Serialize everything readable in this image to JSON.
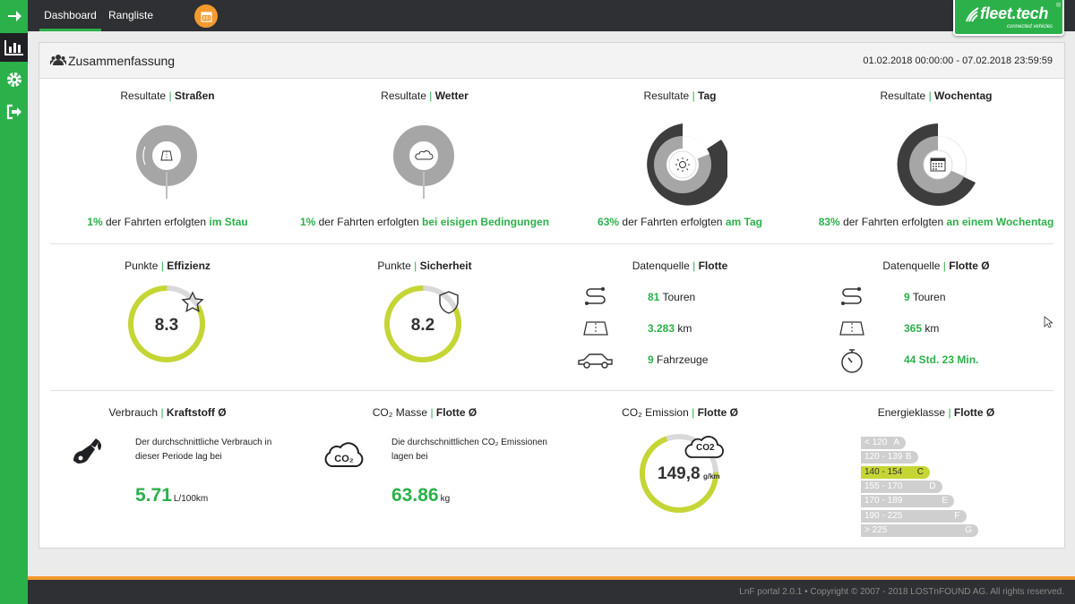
{
  "nav": {
    "tabs": [
      {
        "label": "Dashboard"
      },
      {
        "label": "Rangliste"
      }
    ],
    "logo": {
      "text": "fleet.tech",
      "tagline": "connected vehicles",
      "mark": "®"
    }
  },
  "sidebar": {
    "items": [
      {
        "icon": "arrow-right-icon"
      },
      {
        "icon": "bar-chart-icon",
        "active": true
      },
      {
        "icon": "gear-icon"
      },
      {
        "icon": "sign-out-icon"
      }
    ]
  },
  "summary": {
    "title": "Zusammenfassung",
    "date_range": "01.02.2018 00:00:00 - 07.02.2018 23:59:59"
  },
  "results": [
    {
      "label": "Resultate",
      "sep": "|",
      "name": "Straßen",
      "percent": "1%",
      "text": "der Fahrten erfolgten",
      "highlight": "im Stau",
      "share": 0.01
    },
    {
      "label": "Resultate",
      "sep": "|",
      "name": "Wetter",
      "percent": "1%",
      "text": "der Fahrten erfolgten",
      "highlight": "bei eisigen Bedingungen",
      "share": 0.01
    },
    {
      "label": "Resultate",
      "sep": "|",
      "name": "Tag",
      "percent": "63%",
      "text": "der Fahrten erfolgten",
      "highlight": "am Tag",
      "share": 0.63
    },
    {
      "label": "Resultate",
      "sep": "|",
      "name": "Wochentag",
      "percent": "83%",
      "text": "der Fahrten erfolgten",
      "highlight": "an einem Wochentag",
      "share": 0.83
    }
  ],
  "points": [
    {
      "label": "Punkte",
      "sep": "|",
      "name": "Effizienz",
      "value": "8.3",
      "score": 8.3
    },
    {
      "label": "Punkte",
      "sep": "|",
      "name": "Sicherheit",
      "value": "8.2",
      "score": 8.2
    }
  ],
  "source_fleet": {
    "label": "Datenquelle",
    "sep": "|",
    "name": "Flotte",
    "rows": [
      {
        "value": "81",
        "unit": "Touren"
      },
      {
        "value": "3.283",
        "unit": "km"
      },
      {
        "value": "9",
        "unit": "Fahrzeuge"
      }
    ]
  },
  "source_avg": {
    "label": "Datenquelle",
    "sep": "|",
    "name": "Flotte Ø",
    "rows": [
      {
        "value": "9",
        "unit": "Touren"
      },
      {
        "value": "365",
        "unit": "km"
      },
      {
        "value": "44 Std. 23 Min.",
        "unit": ""
      }
    ]
  },
  "consumption": {
    "label": "Verbrauch",
    "sep": "|",
    "name": "Kraftstoff Ø",
    "desc": "Der durchschnittliche Verbrauch in dieser Periode lag bei",
    "value": "5.71",
    "unit": "L/100km"
  },
  "co2_mass": {
    "label": "CO₂ Masse",
    "sep": "|",
    "name": "Flotte Ø",
    "desc": "Die durchschnittlichen CO₂ Emissionen lagen bei",
    "value": "63.86",
    "unit": "kg"
  },
  "co2_emission": {
    "label": "CO₂ Emission",
    "sep": "|",
    "name": "Flotte Ø",
    "value": "149,8",
    "unit": "g/km",
    "icon_text": "CO2",
    "fill": 0.7
  },
  "energy": {
    "label": "Energieklasse",
    "sep": "|",
    "name": "Flotte Ø",
    "classes": [
      {
        "range": "< 120",
        "cls": "A"
      },
      {
        "range": "120 - 139",
        "cls": "B"
      },
      {
        "range": "140 - 154",
        "cls": "C",
        "active": true
      },
      {
        "range": "155 - 170",
        "cls": "D"
      },
      {
        "range": "170 - 189",
        "cls": "E"
      },
      {
        "range": "190 - 225",
        "cls": "F"
      },
      {
        "range": "> 225",
        "cls": "G"
      }
    ]
  },
  "footer": {
    "text": "LnF portal 2.0.1 • Copyright © 2007 - 2018 LOSTnFOUND AG. All rights reserved."
  },
  "colors": {
    "green": "#2bb14a",
    "lime": "#c5d634",
    "dark": "#3d3d3d",
    "orange": "#f39a2e",
    "grey": "#a6a6a6"
  }
}
